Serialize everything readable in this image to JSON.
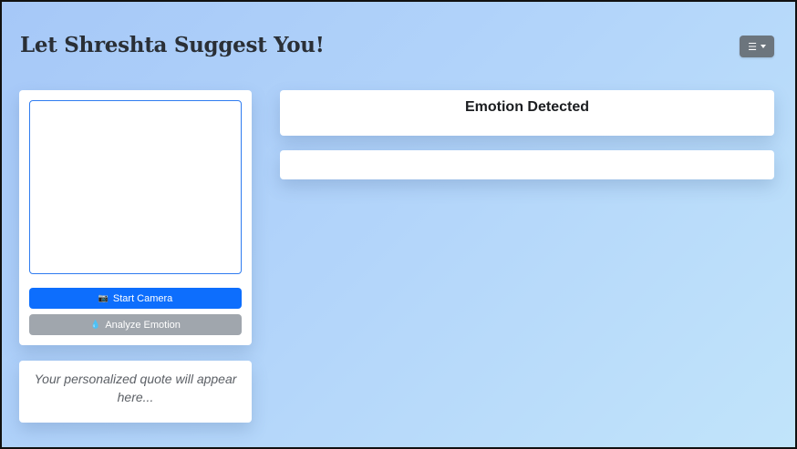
{
  "header": {
    "title": "Let Shreshta Suggest You!",
    "menu_icon": "hamburger-icon"
  },
  "camera_panel": {
    "start_label": "Start Camera",
    "start_icon": "camera-icon",
    "analyze_label": "Analyze Emotion",
    "analyze_icon": "droplet-icon"
  },
  "quote": {
    "placeholder": "Your personalized quote will appear here..."
  },
  "emotion": {
    "title": "Emotion Detected",
    "result": ""
  },
  "colors": {
    "primary": "#0d6efd",
    "disabled": "#a0a6ad",
    "menu": "#6c757d"
  }
}
